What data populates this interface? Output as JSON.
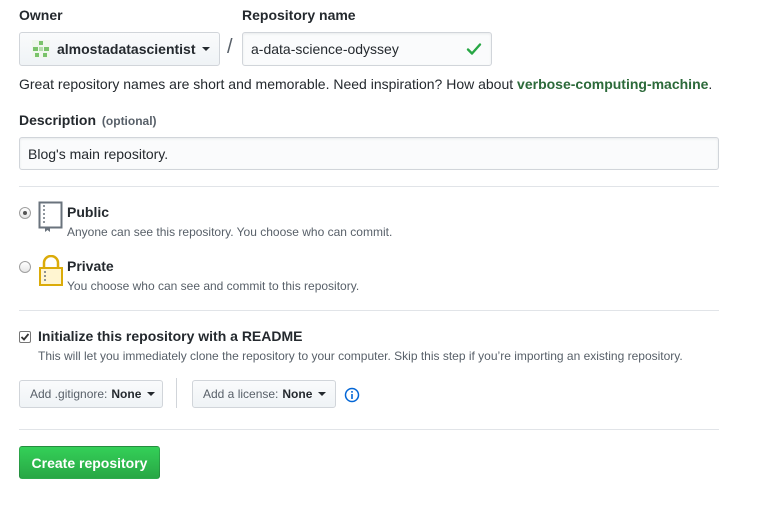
{
  "owner": {
    "label": "Owner",
    "value": "almostadatascientist",
    "avatar_color": "#7ac36a"
  },
  "separator": "/",
  "repository": {
    "label": "Repository name",
    "value": "a-data-science-odyssey",
    "valid_color": "#28a745"
  },
  "name_hint": {
    "text": "Great repository names are short and memorable. Need inspiration? How about ",
    "suggestion": "verbose-computing-machine",
    "end": ".",
    "suggestion_color": "#2c6a3a"
  },
  "description": {
    "label": "Description",
    "optional": "(optional)",
    "value": "Blog's main repository."
  },
  "visibility": {
    "public": {
      "title": "Public",
      "note": "Anyone can see this repository. You choose who can commit.",
      "icon": "repo-book-icon",
      "checked": true
    },
    "private": {
      "title": "Private",
      "note": "You choose who can see and commit to this repository.",
      "icon": "lock-icon",
      "checked": false
    }
  },
  "readme": {
    "title": "Initialize this repository with a README",
    "note": "This will let you immediately clone the repository to your computer. Skip this step if you’re importing an existing repository.",
    "checked": true
  },
  "gitignore": {
    "prefix": "Add .gitignore:",
    "value": "None"
  },
  "license": {
    "prefix": "Add a license:",
    "value": "None"
  },
  "info_icon_color": "#0366d6",
  "create_button": {
    "label": "Create repository",
    "color": "#28a745"
  }
}
